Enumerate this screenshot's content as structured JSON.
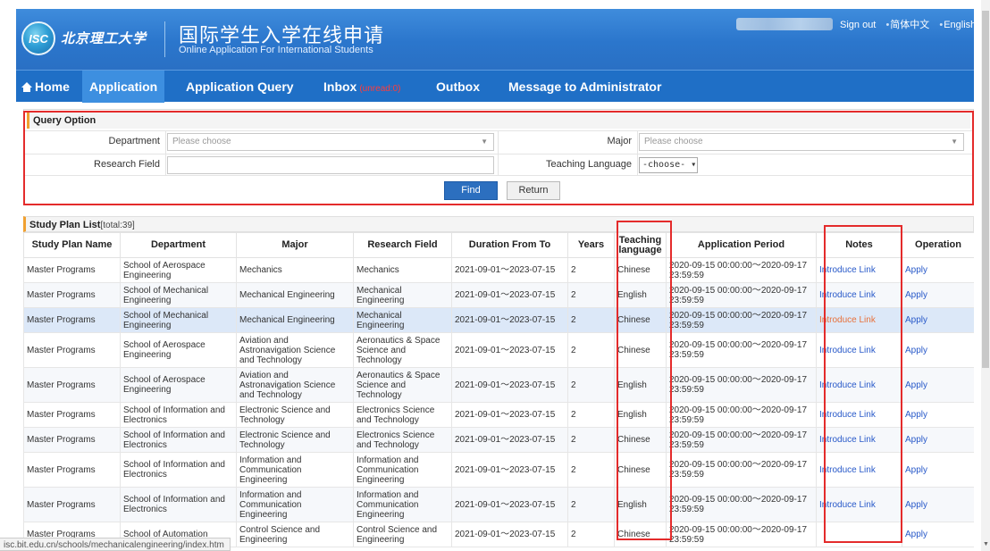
{
  "header": {
    "logo_badge": "ISC",
    "logo_text": "北京理工大学",
    "title_cn": "国际学生入学在线申请",
    "title_en": "Online Application For International Students",
    "links": [
      "Sign out",
      "简体中文",
      "English"
    ]
  },
  "nav": {
    "items": [
      "Home",
      "Application",
      "Application Query",
      "Inbox",
      "Outbox",
      "Message to Administrator"
    ],
    "inbox_badge": "(unread:0)",
    "active": "Application"
  },
  "query": {
    "title": "Query Option",
    "department_label": "Department",
    "department_placeholder": "Please choose",
    "major_label": "Major",
    "major_placeholder": "Please choose",
    "research_label": "Research Field",
    "research_value": "",
    "language_label": "Teaching Language",
    "language_value": "-choose-",
    "find_label": "Find",
    "return_label": "Return"
  },
  "list": {
    "title": "Study Plan List",
    "total": "[total:39]",
    "columns": [
      "Study Plan Name",
      "Department",
      "Major",
      "Research Field",
      "Duration From To",
      "Years",
      "Teaching language",
      "Application Period",
      "Notes",
      "Operation"
    ],
    "rows": [
      {
        "name": "Master Programs",
        "dept": "School of Aerospace Engineering",
        "major": "Mechanics",
        "field": "Mechanics",
        "duration": "2021-09-01～2023-07-15",
        "years": "2",
        "lang": "Chinese",
        "period": "2020-09-15 00:00:00～2020-09-17 23:59:59",
        "notes": "Introduce Link",
        "op": "Apply"
      },
      {
        "name": "Master Programs",
        "dept": "School of Mechanical Engineering",
        "major": "Mechanical Engineering",
        "field": "Mechanical Engineering",
        "duration": "2021-09-01～2023-07-15",
        "years": "2",
        "lang": "English",
        "period": "2020-09-15 00:00:00～2020-09-17 23:59:59",
        "notes": "Introduce Link",
        "op": "Apply"
      },
      {
        "name": "Master Programs",
        "dept": "School of Mechanical Engineering",
        "major": "Mechanical Engineering",
        "field": "Mechanical Engineering",
        "duration": "2021-09-01～2023-07-15",
        "years": "2",
        "lang": "Chinese",
        "period": "2020-09-15 00:00:00～2020-09-17 23:59:59",
        "notes": "Introduce Link",
        "op": "Apply"
      },
      {
        "name": "Master Programs",
        "dept": "School of Aerospace Engineering",
        "major": "Aviation and Astronavigation Science and Technology",
        "field": "Aeronautics & Space Science and Technology",
        "duration": "2021-09-01～2023-07-15",
        "years": "2",
        "lang": "Chinese",
        "period": "2020-09-15 00:00:00～2020-09-17 23:59:59",
        "notes": "Introduce Link",
        "op": "Apply"
      },
      {
        "name": "Master Programs",
        "dept": "School of Aerospace Engineering",
        "major": "Aviation and Astronavigation Science and Technology",
        "field": "Aeronautics & Space Science and Technology",
        "duration": "2021-09-01～2023-07-15",
        "years": "2",
        "lang": "English",
        "period": "2020-09-15 00:00:00～2020-09-17 23:59:59",
        "notes": "Introduce Link",
        "op": "Apply"
      },
      {
        "name": "Master Programs",
        "dept": "School of Information and Electronics",
        "major": "Electronic Science and Technology",
        "field": "Electronics Science and Technology",
        "duration": "2021-09-01～2023-07-15",
        "years": "2",
        "lang": "English",
        "period": "2020-09-15 00:00:00～2020-09-17 23:59:59",
        "notes": "Introduce Link",
        "op": "Apply"
      },
      {
        "name": "Master Programs",
        "dept": "School of Information and Electronics",
        "major": "Electronic Science and Technology",
        "field": "Electronics Science and Technology",
        "duration": "2021-09-01～2023-07-15",
        "years": "2",
        "lang": "Chinese",
        "period": "2020-09-15 00:00:00～2020-09-17 23:59:59",
        "notes": "Introduce Link",
        "op": "Apply"
      },
      {
        "name": "Master Programs",
        "dept": "School of Information and Electronics",
        "major": "Information and Communication Engineering",
        "field": "Information and Communication Engineering",
        "duration": "2021-09-01～2023-07-15",
        "years": "2",
        "lang": "Chinese",
        "period": "2020-09-15 00:00:00～2020-09-17 23:59:59",
        "notes": "Introduce Link",
        "op": "Apply"
      },
      {
        "name": "Master Programs",
        "dept": "School of Information and Electronics",
        "major": "Information and Communication Engineering",
        "field": "Information and Communication Engineering",
        "duration": "2021-09-01～2023-07-15",
        "years": "2",
        "lang": "English",
        "period": "2020-09-15 00:00:00～2020-09-17 23:59:59",
        "notes": "Introduce Link",
        "op": "Apply"
      },
      {
        "name": "Master Programs",
        "dept": "School of Automation",
        "major": "Control Science and Engineering",
        "field": "Control Science and Engineering",
        "duration": "2021-09-01～2023-07-15",
        "years": "2",
        "lang": "Chinese",
        "period": "2020-09-15 00:00:00～2020-09-17 23:59:59",
        "notes": "",
        "op": "Apply"
      }
    ]
  },
  "status_url": "isc.bit.edu.cn/schools/mechanicalengineering/index.htm"
}
